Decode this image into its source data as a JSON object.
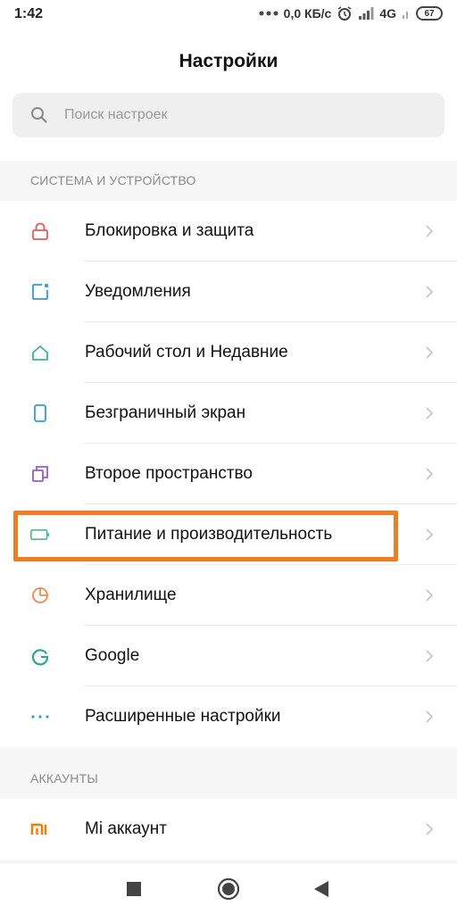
{
  "status_bar": {
    "time": "1:42",
    "network_speed": "0,0 КБ/с",
    "network_type": "4G",
    "battery": "67"
  },
  "header": {
    "title": "Настройки"
  },
  "search": {
    "placeholder": "Поиск настроек"
  },
  "sections": [
    {
      "title": "СИСТЕМА И УСТРОЙСТВО",
      "items": [
        {
          "label": "Блокировка и защита",
          "icon": "lock-icon",
          "color": "#e55a5a"
        },
        {
          "label": "Уведомления",
          "icon": "notifications-icon",
          "color": "#2d9fd9"
        },
        {
          "label": "Рабочий стол и Недавние",
          "icon": "home-icon",
          "color": "#3cb88a"
        },
        {
          "label": "Безграничный экран",
          "icon": "fullscreen-phone-icon",
          "color": "#2d9fd9"
        },
        {
          "label": "Второе пространство",
          "icon": "second-space-icon",
          "color": "#9b59c9"
        },
        {
          "label": "Питание и производительность",
          "icon": "battery-icon",
          "color": "#3cb88a"
        },
        {
          "label": "Хранилище",
          "icon": "storage-pie-icon",
          "color": "#f08a4b"
        },
        {
          "label": "Google",
          "icon": "google-icon",
          "color": "#2ca58d"
        },
        {
          "label": "Расширенные настройки",
          "icon": "more-dots-icon",
          "color": "#2d9fd9"
        }
      ]
    },
    {
      "title": "АККАУНТЫ",
      "items": [
        {
          "label": "Mi аккаунт",
          "icon": "mi-logo-icon",
          "color": "#f57c00"
        }
      ]
    }
  ],
  "highlight": {
    "color": "#f47c20",
    "target": "Питание и производительность"
  },
  "nav": {
    "recents": "recents-square-icon",
    "home": "home-circle-icon",
    "back": "back-triangle-icon"
  }
}
